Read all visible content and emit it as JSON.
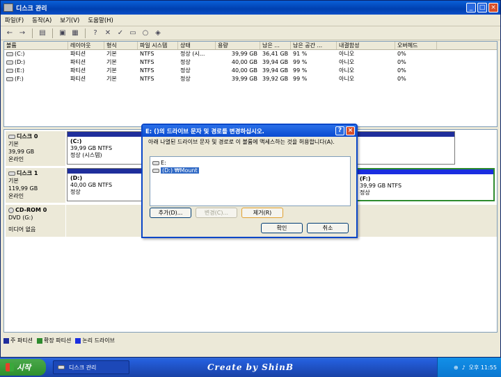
{
  "window": {
    "title": "디스크 관리",
    "min": "_",
    "max": "□",
    "close": "×"
  },
  "menu": [
    "파일(F)",
    "동작(A)",
    "보기(V)",
    "도움말(H)"
  ],
  "columns": [
    "볼륨",
    "레이아웃",
    "형식",
    "파일 시스템",
    "상태",
    "용량",
    "남은 ...",
    "남은 공간 ...",
    "내결함성",
    "오버헤드"
  ],
  "volumes": [
    [
      "(C:)",
      "파티션",
      "기본",
      "NTFS",
      "정상 (시...",
      "39,99 GB",
      "36,41 GB",
      "91 %",
      "아니오",
      "0%"
    ],
    [
      "(D:)",
      "파티션",
      "기본",
      "NTFS",
      "정상",
      "40,00 GB",
      "39,94 GB",
      "99 %",
      "아니오",
      "0%"
    ],
    [
      "(E:)",
      "파티션",
      "기본",
      "NTFS",
      "정상",
      "40,00 GB",
      "39,94 GB",
      "99 %",
      "아니오",
      "0%"
    ],
    [
      "(F:)",
      "파티션",
      "기본",
      "NTFS",
      "정상",
      "39,99 GB",
      "39,92 GB",
      "99 %",
      "아니오",
      "0%"
    ]
  ],
  "disks": {
    "disk0": {
      "name": "디스크 0",
      "type": "기본",
      "size": "39,99 GB",
      "status": "온라인"
    },
    "disk1": {
      "name": "디스크 1",
      "type": "기본",
      "size": "119,99 GB",
      "status": "온라인"
    },
    "cdrom": {
      "name": "CD-ROM 0",
      "drive": "DVD (G:)",
      "status": "미디어 없음"
    }
  },
  "partitions": {
    "c": {
      "name": "(C:)",
      "size": "39,99 GB NTFS",
      "status": "정상 (시스템)"
    },
    "d": {
      "name": "(D:)",
      "size": "40,00 GB NTFS",
      "status": "정상"
    },
    "f": {
      "name": "(F:)",
      "size": "39,99 GB NTFS",
      "status": "정상"
    }
  },
  "legend": [
    "주 파티션",
    "확장 파티션",
    "논리 드라이브"
  ],
  "legend_colors": [
    "#1f2e9c",
    "#2e8b2e",
    "#1a2ee0"
  ],
  "dialog": {
    "title": "E: ()의 드라이브 문자 및 경로를 변경하십시오.",
    "help": "?",
    "close": "×",
    "message": "아래 나열된 드라이브 문자 및 경로로 이 볼륨에 액세스하는 것을 허용합니다(A).",
    "items": [
      "E:",
      "(D:) ₩Mount"
    ],
    "buttons": {
      "add": "추가(D)...",
      "change": "변경(C)...",
      "remove": "제거(R)",
      "ok": "확인",
      "cancel": "취소"
    }
  },
  "taskbar": {
    "start": "시작",
    "task": "디스크 관리",
    "brand": "Create by ShinB",
    "time": "오후 11:55"
  }
}
